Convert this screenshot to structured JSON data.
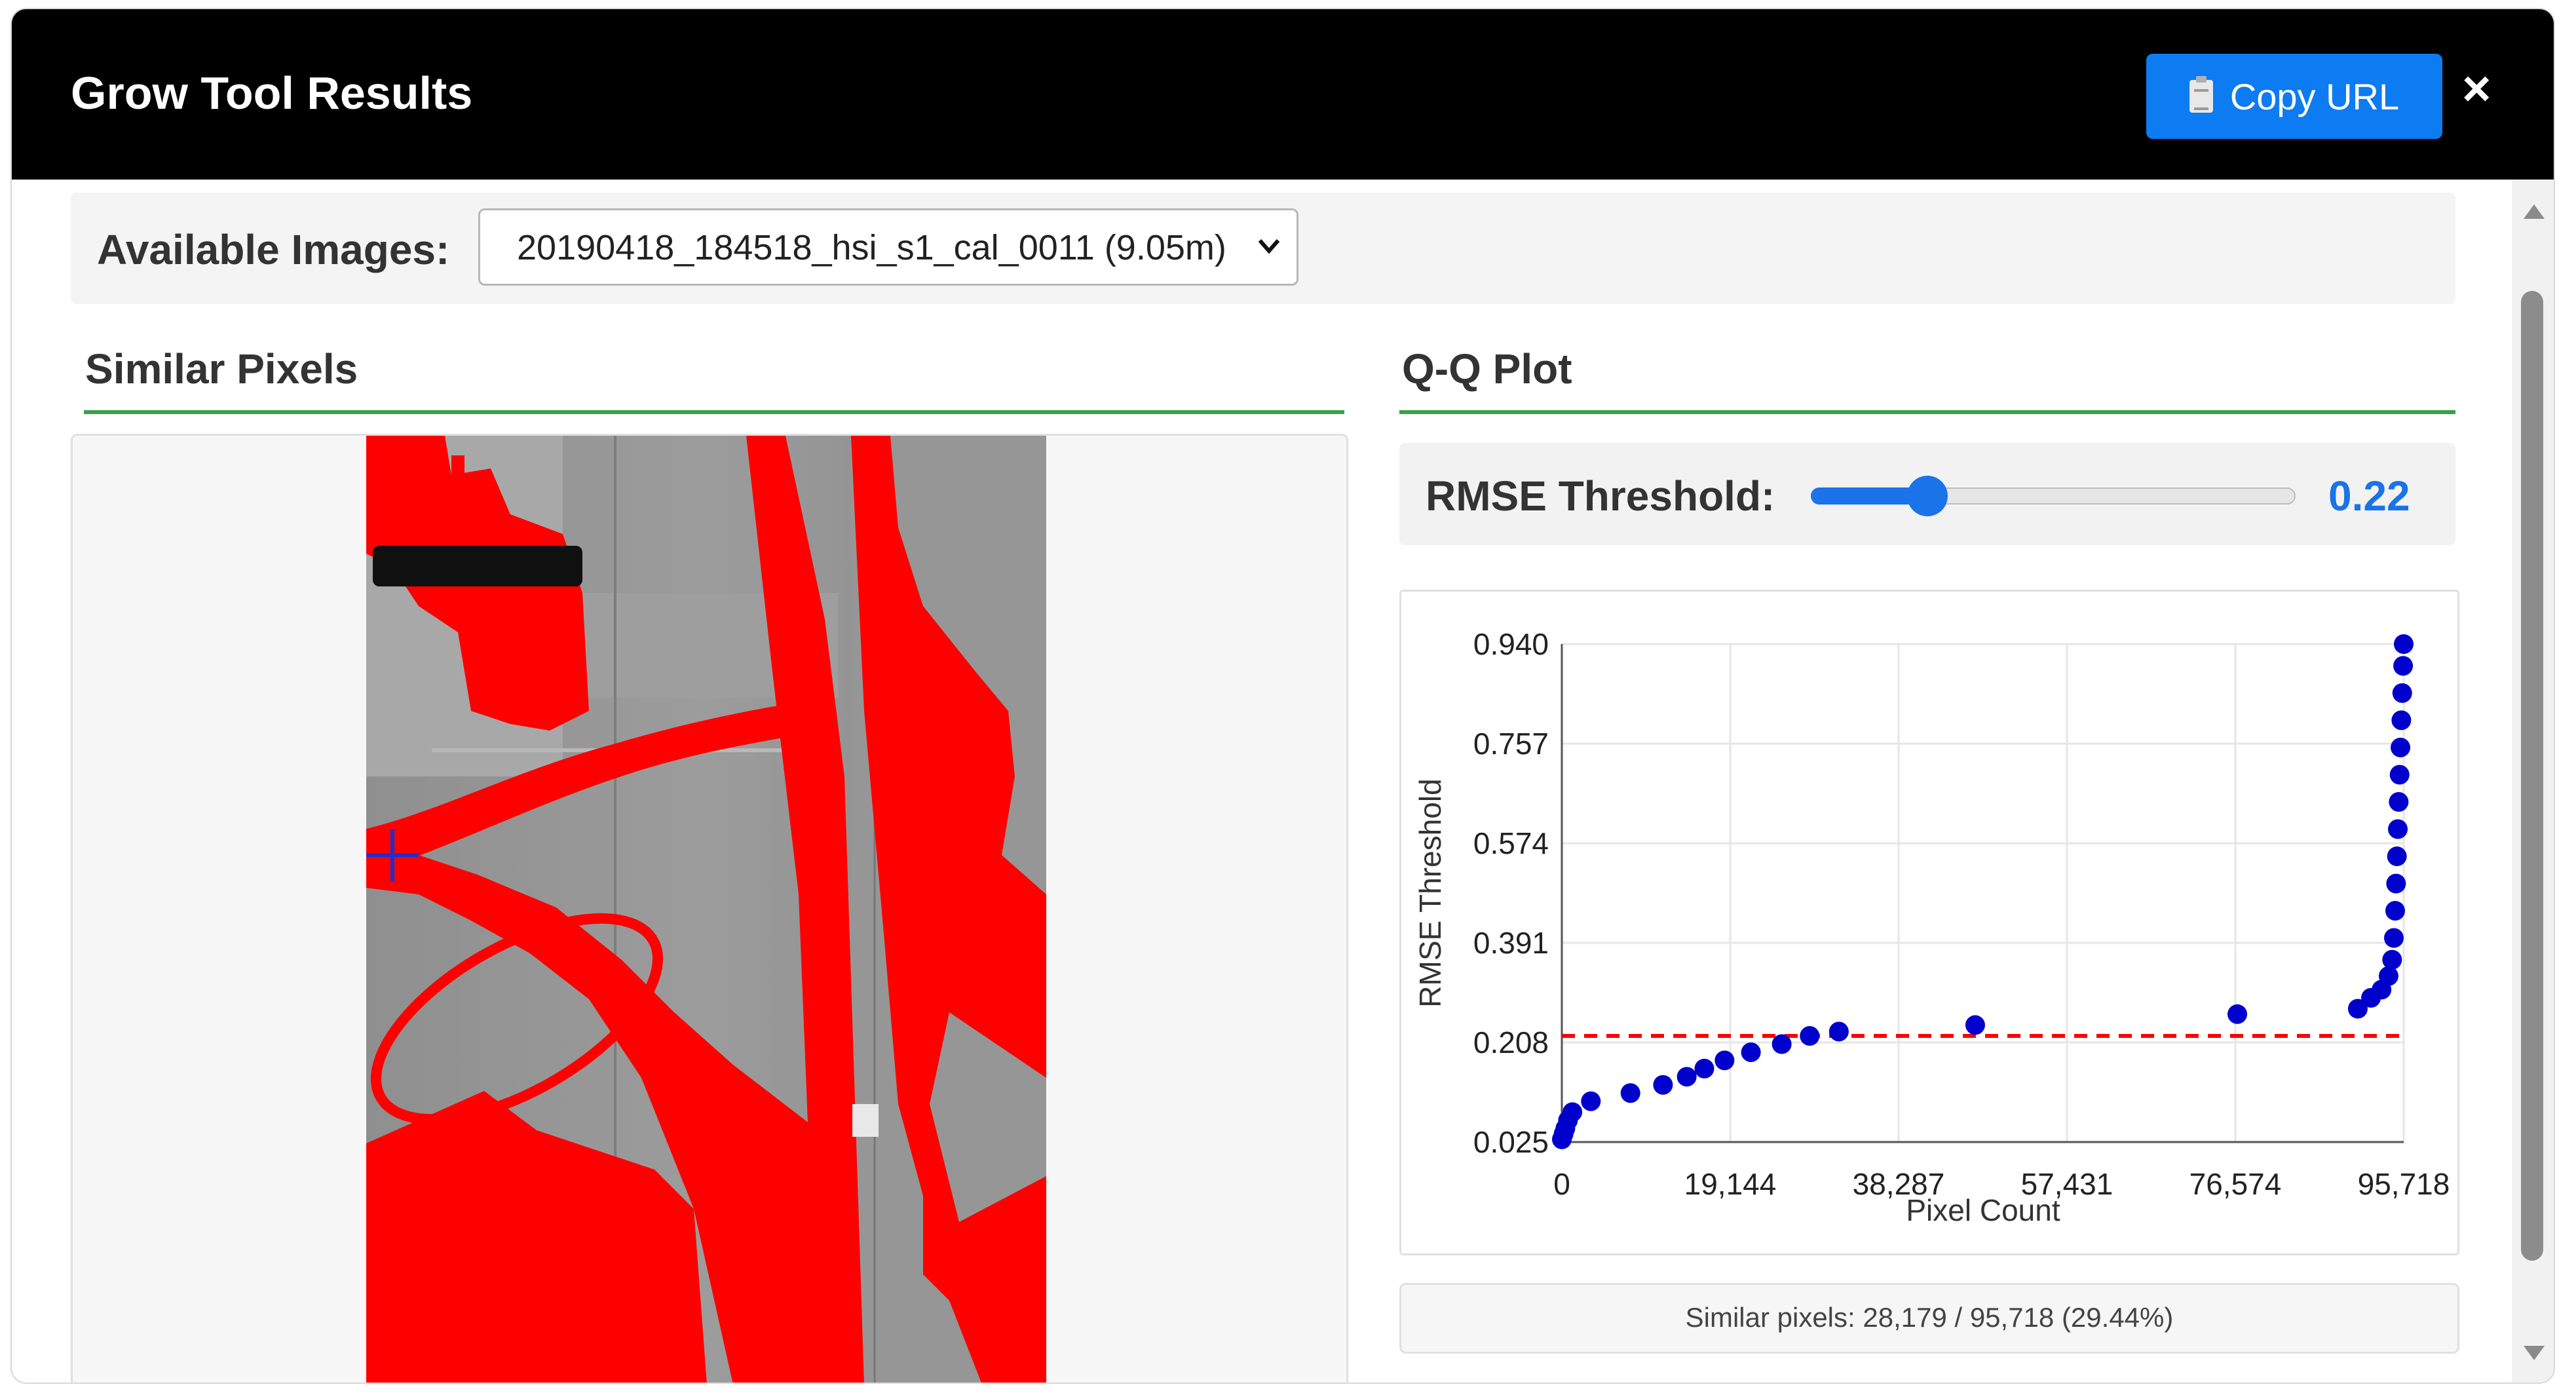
{
  "dialog": {
    "title": "Grow Tool Results",
    "copy_button_label": "Copy URL",
    "close_label": "×"
  },
  "images": {
    "label": "Available Images:",
    "selected": "20190418_184518_hsi_s1_cal_0011 (9.05m)"
  },
  "similar_pixels": {
    "title": "Similar Pixels",
    "overlay_color": "#ff0000",
    "seed_marker_color": "#1f2fd0"
  },
  "qq_plot": {
    "title": "Q-Q Plot",
    "rmse_label": "RMSE Threshold:",
    "rmse_value": "0.22",
    "rmse_slider_fraction": 0.24,
    "status_text": "Similar pixels: 28,179 / 95,718 (29.44%)"
  },
  "chart_data": {
    "type": "scatter",
    "xlabel": "Pixel Count",
    "ylabel": "RMSE Threshold",
    "x_ticks": [
      "0",
      "19,144",
      "38,287",
      "57,431",
      "76,574",
      "95,718"
    ],
    "y_ticks": [
      "0.940",
      "0.757",
      "0.574",
      "0.391",
      "0.208",
      "0.025"
    ],
    "xlim": [
      0,
      95718
    ],
    "ylim": [
      0.025,
      0.94
    ],
    "grid": true,
    "threshold": 0.22,
    "threshold_color": "#ff0000",
    "point_color": "#0000cc",
    "points": [
      [
        0,
        0.03
      ],
      [
        200,
        0.04
      ],
      [
        400,
        0.05
      ],
      [
        700,
        0.065
      ],
      [
        1200,
        0.08
      ],
      [
        3300,
        0.1
      ],
      [
        7800,
        0.115
      ],
      [
        11500,
        0.13
      ],
      [
        14200,
        0.145
      ],
      [
        16200,
        0.16
      ],
      [
        18500,
        0.175
      ],
      [
        21500,
        0.19
      ],
      [
        25000,
        0.205
      ],
      [
        28179,
        0.22
      ],
      [
        31500,
        0.228
      ],
      [
        47000,
        0.24
      ],
      [
        76800,
        0.26
      ],
      [
        90500,
        0.27
      ],
      [
        92000,
        0.29
      ],
      [
        93200,
        0.305
      ],
      [
        94000,
        0.33
      ],
      [
        94400,
        0.36
      ],
      [
        94600,
        0.4
      ],
      [
        94750,
        0.45
      ],
      [
        94850,
        0.5
      ],
      [
        94950,
        0.55
      ],
      [
        95050,
        0.6
      ],
      [
        95150,
        0.65
      ],
      [
        95250,
        0.7
      ],
      [
        95350,
        0.75
      ],
      [
        95450,
        0.8
      ],
      [
        95550,
        0.85
      ],
      [
        95650,
        0.9
      ],
      [
        95718,
        0.94
      ]
    ]
  }
}
